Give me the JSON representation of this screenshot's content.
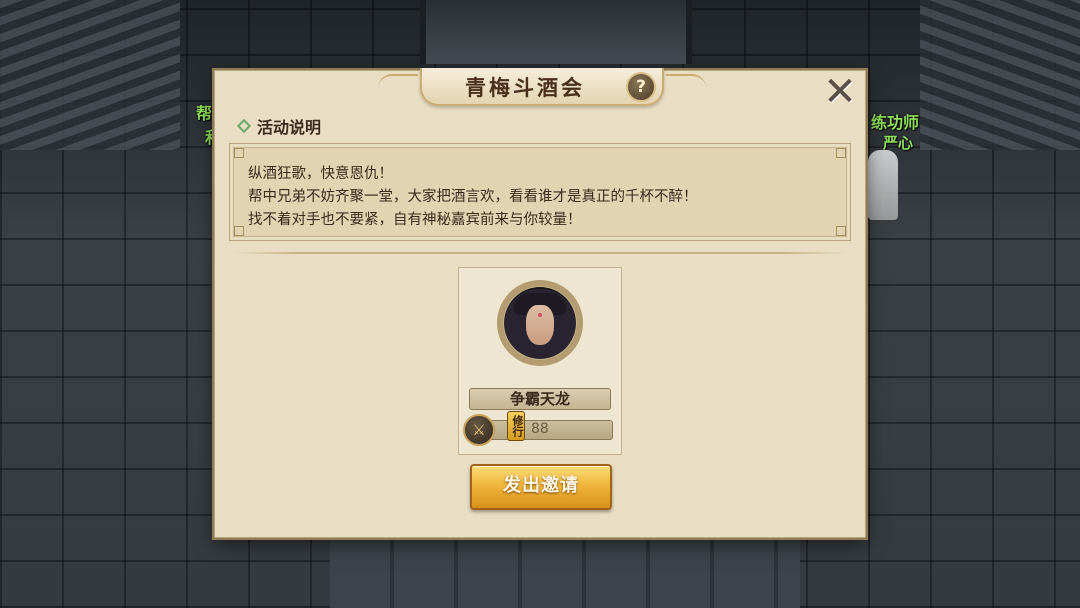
{
  "scene": {
    "npc_left_top": "帮",
    "npc_left_bottom": "和",
    "npc_right_title": "练功师",
    "npc_right_name": "严心"
  },
  "dialog": {
    "title": "青梅斗酒会",
    "help_label": "?",
    "close_label": "✕",
    "section_title": "活动说明",
    "description": [
      "纵酒狂歌，快意恩仇！",
      "帮中兄弟不妨齐聚一堂，大家把酒言欢，看看谁才是真正的千杯不醉！",
      "找不着对手也不要紧，自有神秘嘉宾前来与你较量！"
    ],
    "opponent": {
      "name": "争霸天龙",
      "stat_tag": "修行",
      "stat_value": "88",
      "stat_icon": "sword-icon"
    },
    "invite_label": "发出邀请"
  },
  "colors": {
    "panel_bg": "#e9dec4",
    "text_dark": "#3b2a1c",
    "npc_name": "#8fe05a",
    "button_gold": "#f0b63a"
  }
}
